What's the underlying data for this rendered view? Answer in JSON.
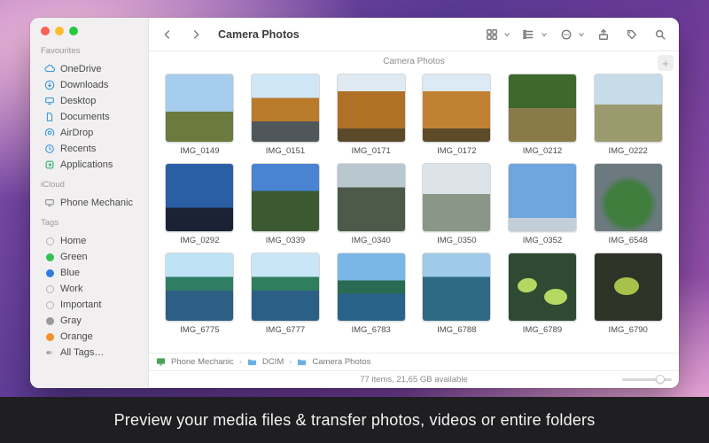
{
  "caption": "Preview your media files & transfer photos, videos or entire folders",
  "window": {
    "title": "Camera Photos",
    "subtitle": "Camera Photos"
  },
  "sidebar": {
    "sections": [
      {
        "header": "Favourites",
        "items": [
          {
            "label": "OneDrive",
            "icon": "cloud",
            "color": "#3a9ad8"
          },
          {
            "label": "Downloads",
            "icon": "download",
            "color": "#3a9ad8"
          },
          {
            "label": "Desktop",
            "icon": "desktop",
            "color": "#3a9ad8"
          },
          {
            "label": "Documents",
            "icon": "doc",
            "color": "#3a9ad8"
          },
          {
            "label": "AirDrop",
            "icon": "airdrop",
            "color": "#3a9ad8"
          },
          {
            "label": "Recents",
            "icon": "clock",
            "color": "#3a9ad8"
          },
          {
            "label": "Applications",
            "icon": "app",
            "color": "#2fb36b"
          }
        ]
      },
      {
        "header": "iCloud",
        "items": [
          {
            "label": "Phone Mechanic",
            "icon": "device",
            "color": "#8a8a8a"
          }
        ]
      },
      {
        "header": "Tags",
        "items": [
          {
            "label": "Home",
            "tag": "#ffffff"
          },
          {
            "label": "Green",
            "tag": "#32c153"
          },
          {
            "label": "Blue",
            "tag": "#2f7de0"
          },
          {
            "label": "Work",
            "tag": "#ffffff"
          },
          {
            "label": "Important",
            "tag": "#ffffff"
          },
          {
            "label": "Gray",
            "tag": "#9a9a9a"
          },
          {
            "label": "Orange",
            "tag": "#f0942a"
          },
          {
            "label": "All Tags…",
            "icon": "alltags",
            "color": "#8a8a8a"
          }
        ]
      }
    ]
  },
  "path": [
    "Phone Mechanic",
    "DCIM",
    "Camera Photos"
  ],
  "status": "77 items, 21,65 GB available",
  "items": [
    {
      "name": "IMG_0149",
      "cls": "sky-mtn"
    },
    {
      "name": "IMG_0151",
      "cls": "autumn-road"
    },
    {
      "name": "IMG_0171",
      "cls": "autumn"
    },
    {
      "name": "IMG_0172",
      "cls": "autumn2"
    },
    {
      "name": "IMG_0212",
      "cls": "forest-path"
    },
    {
      "name": "IMG_0222",
      "cls": "village"
    },
    {
      "name": "IMG_0292",
      "cls": "bluepeak"
    },
    {
      "name": "IMG_0339",
      "cls": "hillblue"
    },
    {
      "name": "IMG_0340",
      "cls": "castle"
    },
    {
      "name": "IMG_0350",
      "cls": "misty"
    },
    {
      "name": "IMG_0352",
      "cls": "sky"
    },
    {
      "name": "IMG_6548",
      "cls": "stadium"
    },
    {
      "name": "IMG_6775",
      "cls": "lake"
    },
    {
      "name": "IMG_6777",
      "cls": "lake2"
    },
    {
      "name": "IMG_6783",
      "cls": "coast"
    },
    {
      "name": "IMG_6788",
      "cls": "river"
    },
    {
      "name": "IMG_6789",
      "cls": "lilies"
    },
    {
      "name": "IMG_6790",
      "cls": "moss"
    }
  ]
}
